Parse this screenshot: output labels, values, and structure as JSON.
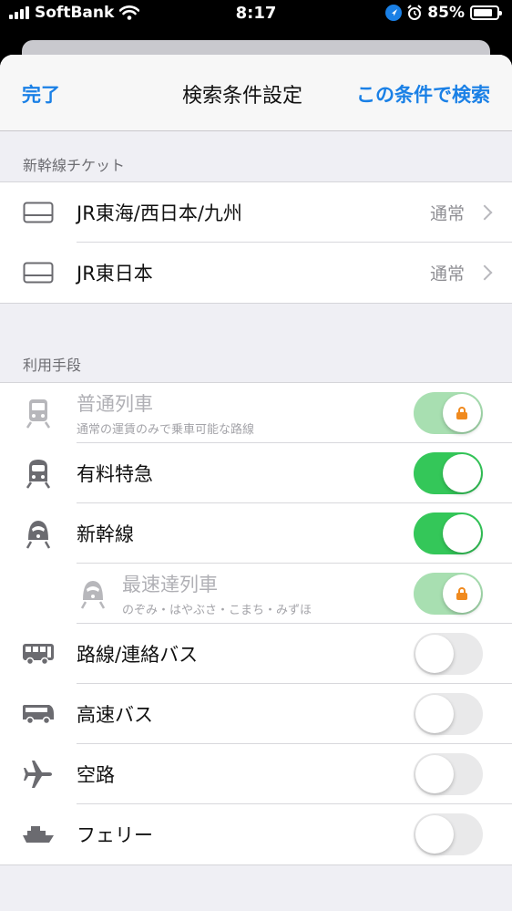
{
  "status_bar": {
    "carrier": "SoftBank",
    "time": "8:17",
    "battery": "85%"
  },
  "nav": {
    "done_label": "完了",
    "title": "検索条件設定",
    "search_label": "この条件で検索"
  },
  "sections": {
    "tickets_header": "新幹線チケット",
    "transport_header": "利用手段"
  },
  "tickets": [
    {
      "label": "JR東海/西日本/九州",
      "value": "通常"
    },
    {
      "label": "JR東日本",
      "value": "通常"
    }
  ],
  "transport": [
    {
      "label": "普通列車",
      "sub": "通常の運賃のみで乗車可能な路線",
      "state": "on",
      "locked": true,
      "disabled": true,
      "icon": "local-train-icon"
    },
    {
      "label": "有料特急",
      "state": "on",
      "locked": false,
      "icon": "express-train-icon"
    },
    {
      "label": "新幹線",
      "state": "on",
      "locked": false,
      "icon": "shinkansen-icon"
    },
    {
      "label": "最速達列車",
      "sub": "のぞみ・はやぶさ・こまち・みずほ",
      "state": "on",
      "locked": true,
      "disabled": true,
      "indent": true,
      "icon": "fastest-train-icon"
    },
    {
      "label": "路線/連絡バス",
      "state": "off",
      "icon": "route-bus-icon"
    },
    {
      "label": "高速バス",
      "state": "off",
      "icon": "highway-bus-icon"
    },
    {
      "label": "空路",
      "state": "off",
      "icon": "airplane-icon"
    },
    {
      "label": "フェリー",
      "state": "off",
      "icon": "ferry-icon"
    }
  ],
  "colors": {
    "accent": "#1a80e6",
    "toggle_on": "#34c759",
    "toggle_locked": "#a8dfb1",
    "lock": "#f08a1f"
  }
}
